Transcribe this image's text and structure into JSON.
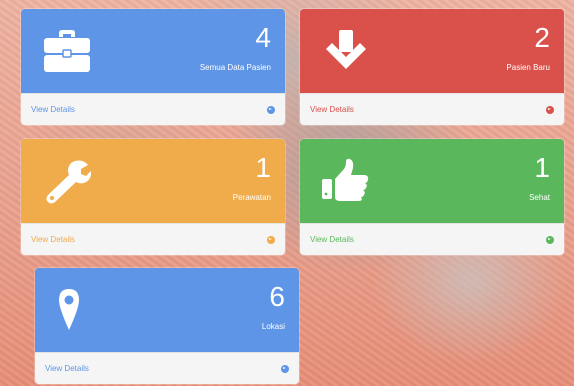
{
  "panels": [
    {
      "id": "all-patients",
      "count": "4",
      "label": "Semua Data Pasien",
      "link": "View Details",
      "color": "#5f95e6",
      "icon": "briefcase-icon"
    },
    {
      "id": "new-patients",
      "count": "2",
      "label": "Pasien Baru",
      "link": "View Details",
      "color": "#da504b",
      "icon": "arrow-down-icon"
    },
    {
      "id": "treatment",
      "count": "1",
      "label": "Perawatan",
      "link": "View Details",
      "color": "#f0ab4a",
      "icon": "wrench-icon"
    },
    {
      "id": "healthy",
      "count": "1",
      "label": "Sehat",
      "link": "View Details",
      "color": "#5bb75b",
      "icon": "thumbs-up-icon"
    },
    {
      "id": "location",
      "count": "6",
      "label": "Lokasi",
      "link": "View Details",
      "color": "#5f95e6",
      "icon": "map-marker-icon"
    }
  ]
}
